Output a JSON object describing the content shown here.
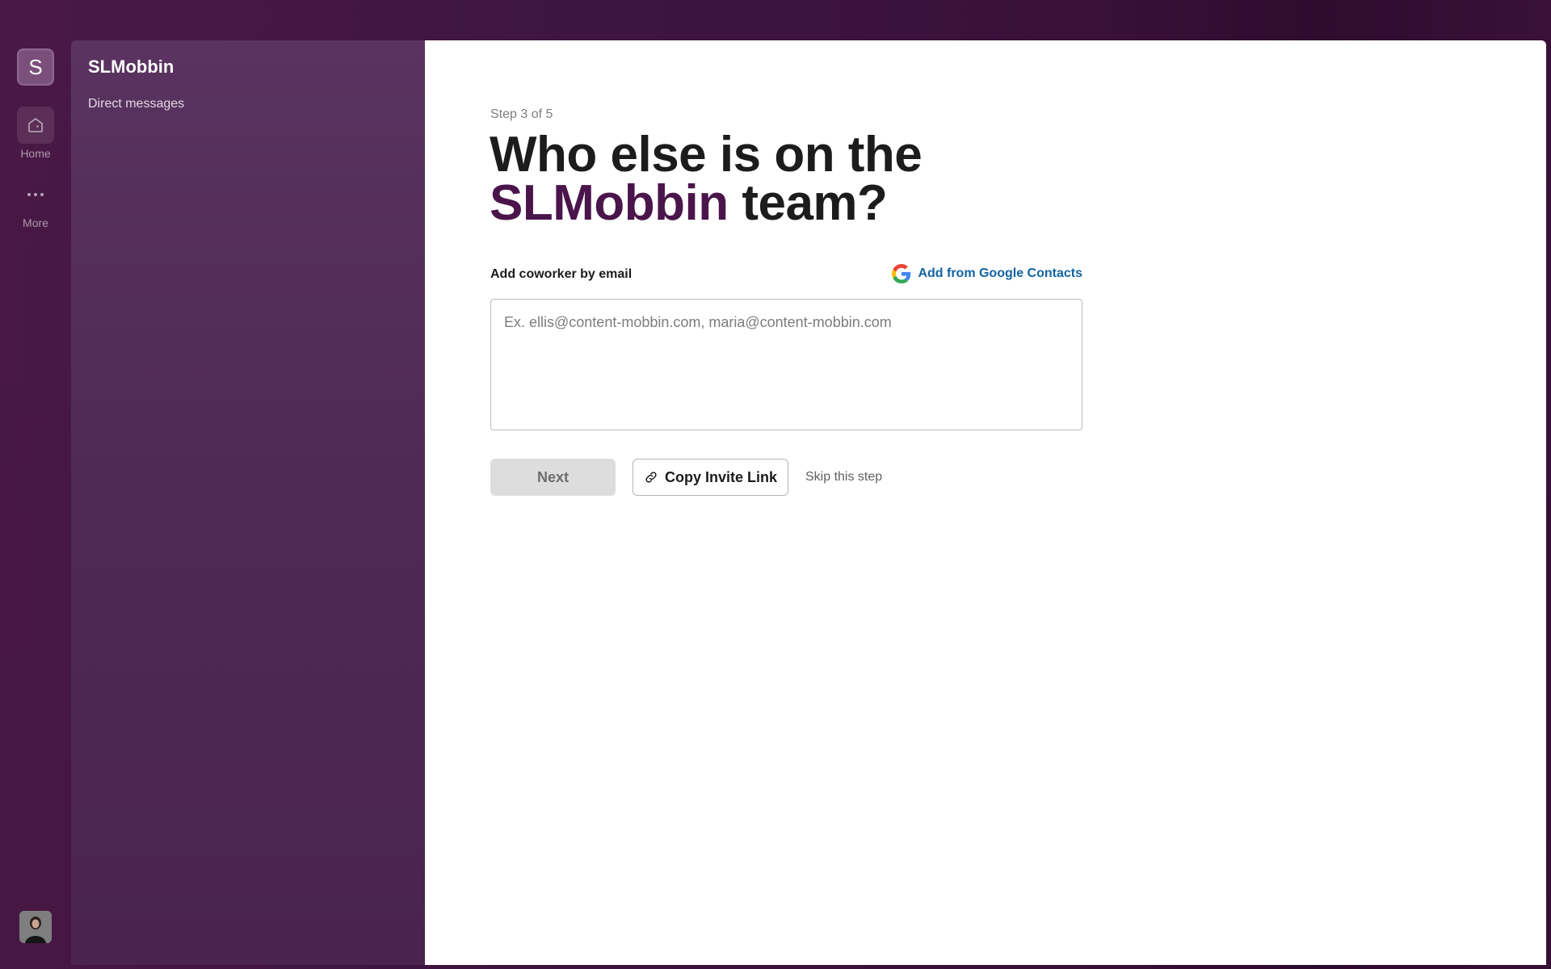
{
  "rail": {
    "workspace_initial": "S",
    "home_label": "Home",
    "more_label": "More"
  },
  "sidebar": {
    "workspace_name": "SLMobbin",
    "items": [
      {
        "label": "Direct messages"
      }
    ]
  },
  "main": {
    "step_text": "Step 3 of 5",
    "heading_prefix": "Who else is on the",
    "heading_accent": "SLMobbin",
    "heading_suffix": " team?",
    "add_label": "Add coworker by email",
    "google_link": "Add from Google Contacts",
    "email_placeholder": "Ex. ellis@content-mobbin.com, maria@content-mobbin.com",
    "next_label": "Next",
    "copy_label": "Copy Invite Link",
    "skip_label": "Skip this step"
  },
  "colors": {
    "brand_aubergine": "#4a154b",
    "link_blue": "#1264a3"
  }
}
